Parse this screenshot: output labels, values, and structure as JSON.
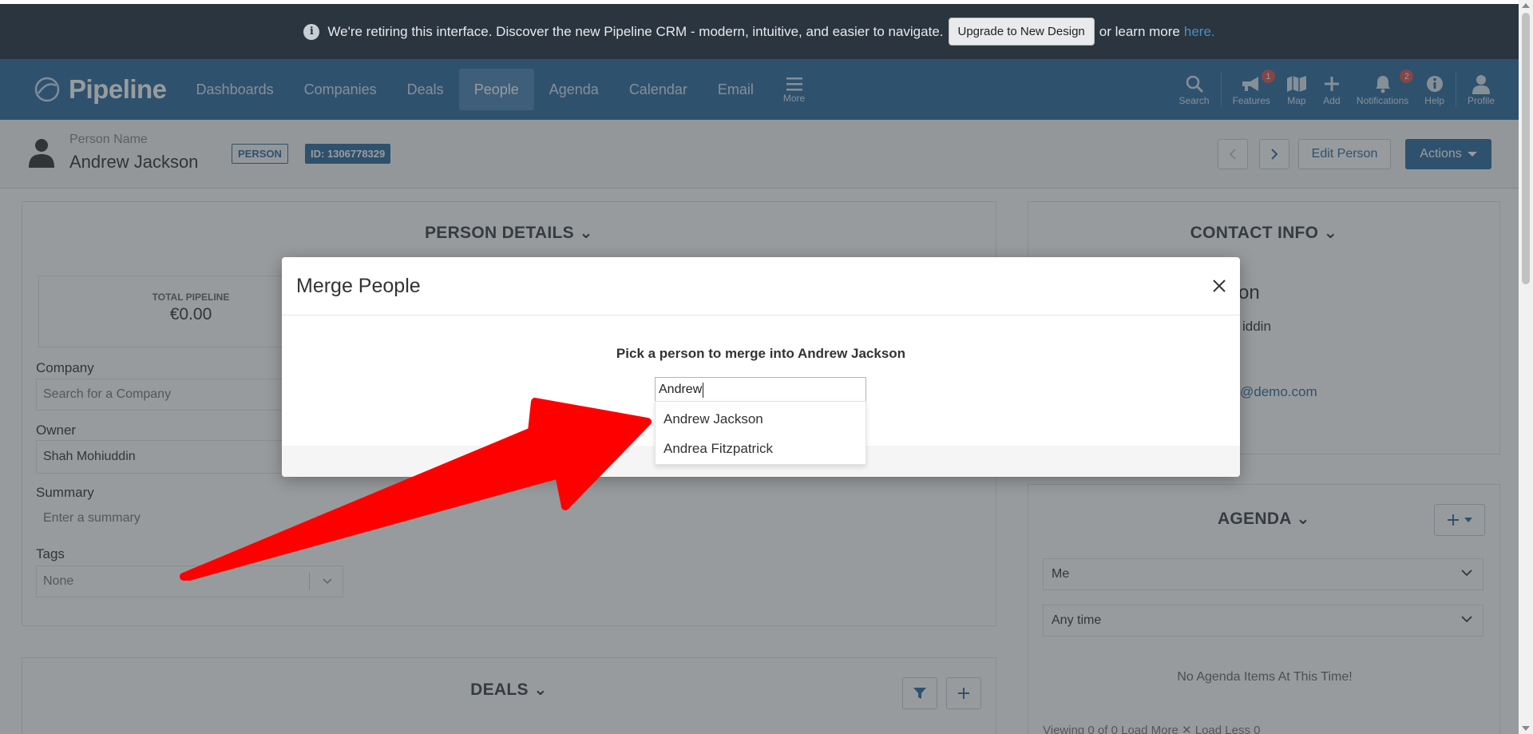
{
  "banner": {
    "message": "We're retiring this interface. Discover the new Pipeline CRM - modern, intuitive, and easier to navigate.",
    "upgrade_button": "Upgrade to New Design",
    "learn_more_text": "or learn more",
    "learn_more_link": "here."
  },
  "nav": {
    "brand": "Pipeline",
    "items": [
      "Dashboards",
      "Companies",
      "Deals",
      "People",
      "Agenda",
      "Calendar",
      "Email"
    ],
    "active_item": "People",
    "more_label": "More",
    "tools": {
      "search": "Search",
      "features": "Features",
      "features_badge": "1",
      "map": "Map",
      "add": "Add",
      "notifications": "Notifications",
      "notifications_badge": "2",
      "help": "Help",
      "profile": "Profile"
    }
  },
  "page_header": {
    "label": "Person Name",
    "name": "Andrew Jackson",
    "type_tag": "PERSON",
    "id_tag": "ID: 1306778329",
    "edit_button": "Edit Person",
    "actions_button": "Actions"
  },
  "person_details": {
    "title": "PERSON DETAILS",
    "total_pipeline_label": "TOTAL PIPELINE",
    "total_pipeline_value": "€0.00",
    "company_label": "Company",
    "company_placeholder": "Search for a Company",
    "owner_label": "Owner",
    "owner_value": "Shah Mohiuddin",
    "summary_label": "Summary",
    "summary_placeholder": "Enter a summary",
    "tags_label": "Tags",
    "tags_value": "None"
  },
  "deals": {
    "title": "DEALS"
  },
  "contact_info": {
    "title": "CONTACT INFO",
    "name_partial": "on",
    "owner_partial": "iddin",
    "email_partial": "@demo.com"
  },
  "agenda": {
    "title": "AGENDA",
    "filter_who": "Me",
    "filter_when": "Any time",
    "empty_text": "No Agenda Items At This Time!",
    "footer_partial": "Viewing 0 of 0   Load More ✕   Load Less 0"
  },
  "modal": {
    "title": "Merge People",
    "prompt": "Pick a person to merge into Andrew Jackson",
    "search_value": "Andrew",
    "suggestions": [
      "Andrew Jackson",
      "Andrea Fitzpatrick"
    ]
  },
  "colors": {
    "brand_blue": "#2b6aa0",
    "banner_bg": "#2a353f",
    "annotation_arrow": "#ff0000",
    "badge_red": "#d9534f"
  }
}
